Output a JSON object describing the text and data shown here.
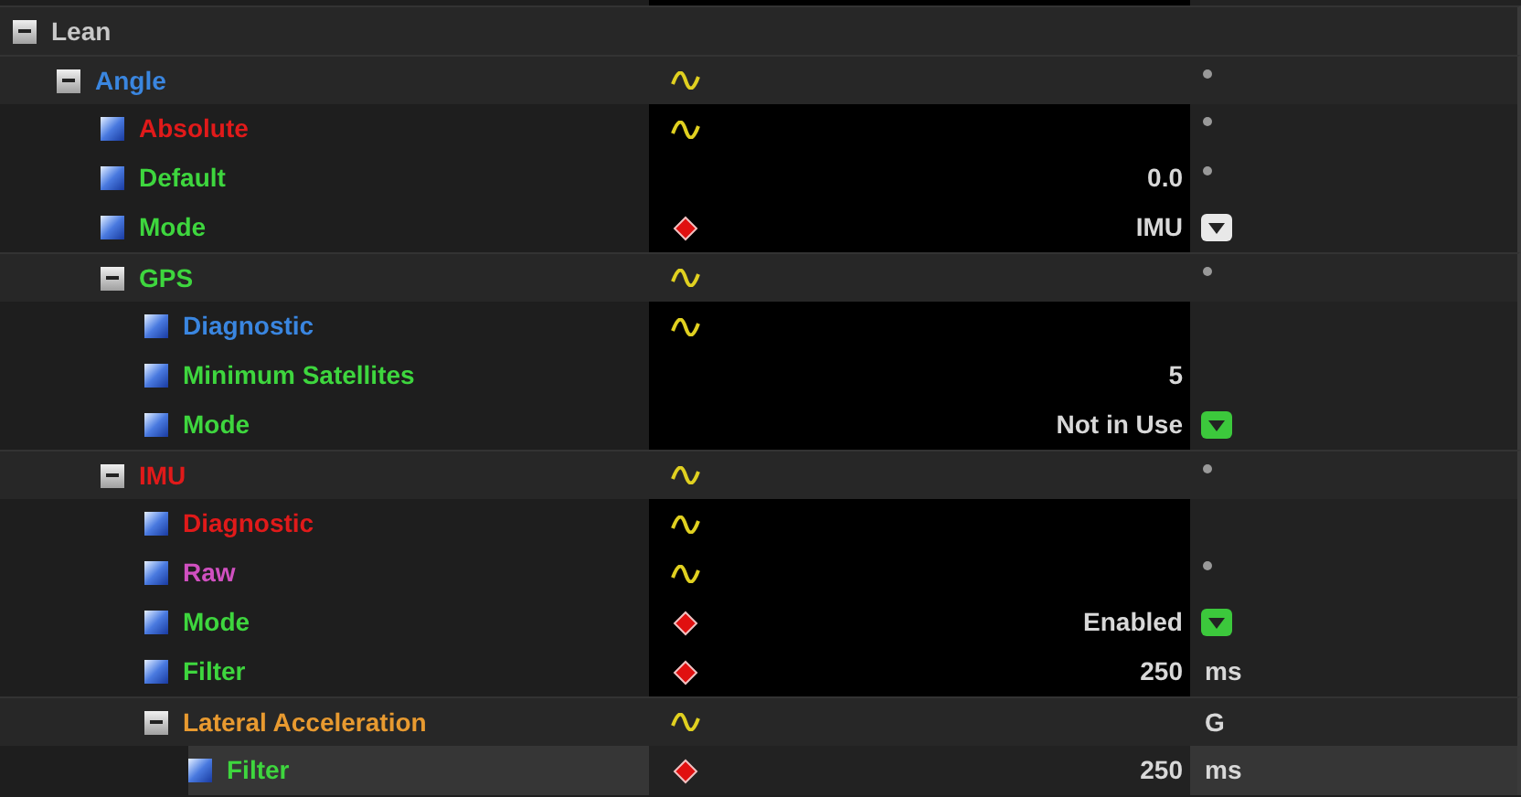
{
  "tree": [
    {
      "label": "Lean",
      "kind": "group",
      "color": "#c8c8c8",
      "expanded": true,
      "selected": false,
      "children": [
        {
          "label": "Angle",
          "kind": "group",
          "color": "#3a86e0",
          "expanded": true,
          "selected": false,
          "indicator": {
            "kind": "wave"
          },
          "suffix": {
            "kind": "dot"
          },
          "children": [
            {
              "label": "Absolute",
              "kind": "param",
              "color": "#e01a1a",
              "selected": false,
              "indicator": {
                "kind": "wave"
              },
              "suffix": {
                "kind": "dot"
              }
            },
            {
              "label": "Default",
              "kind": "param",
              "color": "#3ed63e",
              "selected": false,
              "value": "0.0",
              "suffix": {
                "kind": "dot"
              }
            },
            {
              "label": "Mode",
              "kind": "param",
              "color": "#3ed63e",
              "selected": false,
              "indicator": {
                "kind": "diamond"
              },
              "value": "IMU",
              "suffix": {
                "kind": "dropdown",
                "color": "#e8e8e8"
              }
            },
            {
              "label": "GPS",
              "kind": "group",
              "color": "#3ed63e",
              "expanded": true,
              "selected": false,
              "indicator": {
                "kind": "wave"
              },
              "suffix": {
                "kind": "dot"
              },
              "children": [
                {
                  "label": "Diagnostic",
                  "kind": "param",
                  "color": "#3a86e0",
                  "selected": false,
                  "indicator": {
                    "kind": "wave"
                  }
                },
                {
                  "label": "Minimum Satellites",
                  "kind": "param",
                  "color": "#3ed63e",
                  "selected": false,
                  "value": "5"
                },
                {
                  "label": "Mode",
                  "kind": "param",
                  "color": "#3ed63e",
                  "selected": false,
                  "value": "Not in Use",
                  "suffix": {
                    "kind": "dropdown",
                    "color": "#3cc83c"
                  }
                }
              ]
            },
            {
              "label": "IMU",
              "kind": "group",
              "color": "#e01a1a",
              "expanded": true,
              "selected": false,
              "indicator": {
                "kind": "wave"
              },
              "suffix": {
                "kind": "dot"
              },
              "children": [
                {
                  "label": "Diagnostic",
                  "kind": "param",
                  "color": "#e01a1a",
                  "selected": false,
                  "indicator": {
                    "kind": "wave"
                  }
                },
                {
                  "label": "Raw",
                  "kind": "param",
                  "color": "#d050c0",
                  "selected": false,
                  "indicator": {
                    "kind": "wave"
                  },
                  "suffix": {
                    "kind": "dot"
                  }
                },
                {
                  "label": "Mode",
                  "kind": "param",
                  "color": "#3ed63e",
                  "selected": false,
                  "indicator": {
                    "kind": "diamond"
                  },
                  "value": "Enabled",
                  "suffix": {
                    "kind": "dropdown",
                    "color": "#3cc83c"
                  }
                },
                {
                  "label": "Filter",
                  "kind": "param",
                  "color": "#3ed63e",
                  "selected": false,
                  "indicator": {
                    "kind": "diamond"
                  },
                  "value": "250",
                  "unit": "ms"
                },
                {
                  "label": "Lateral Acceleration",
                  "kind": "group",
                  "color": "#e89a30",
                  "expanded": true,
                  "selected": false,
                  "indicator": {
                    "kind": "wave"
                  },
                  "unit": "G",
                  "children": [
                    {
                      "label": "Filter",
                      "kind": "param",
                      "color": "#3ed63e",
                      "selected": true,
                      "indicator": {
                        "kind": "diamond"
                      },
                      "value": "250",
                      "unit": "ms"
                    }
                  ]
                }
              ]
            }
          ]
        }
      ]
    }
  ]
}
